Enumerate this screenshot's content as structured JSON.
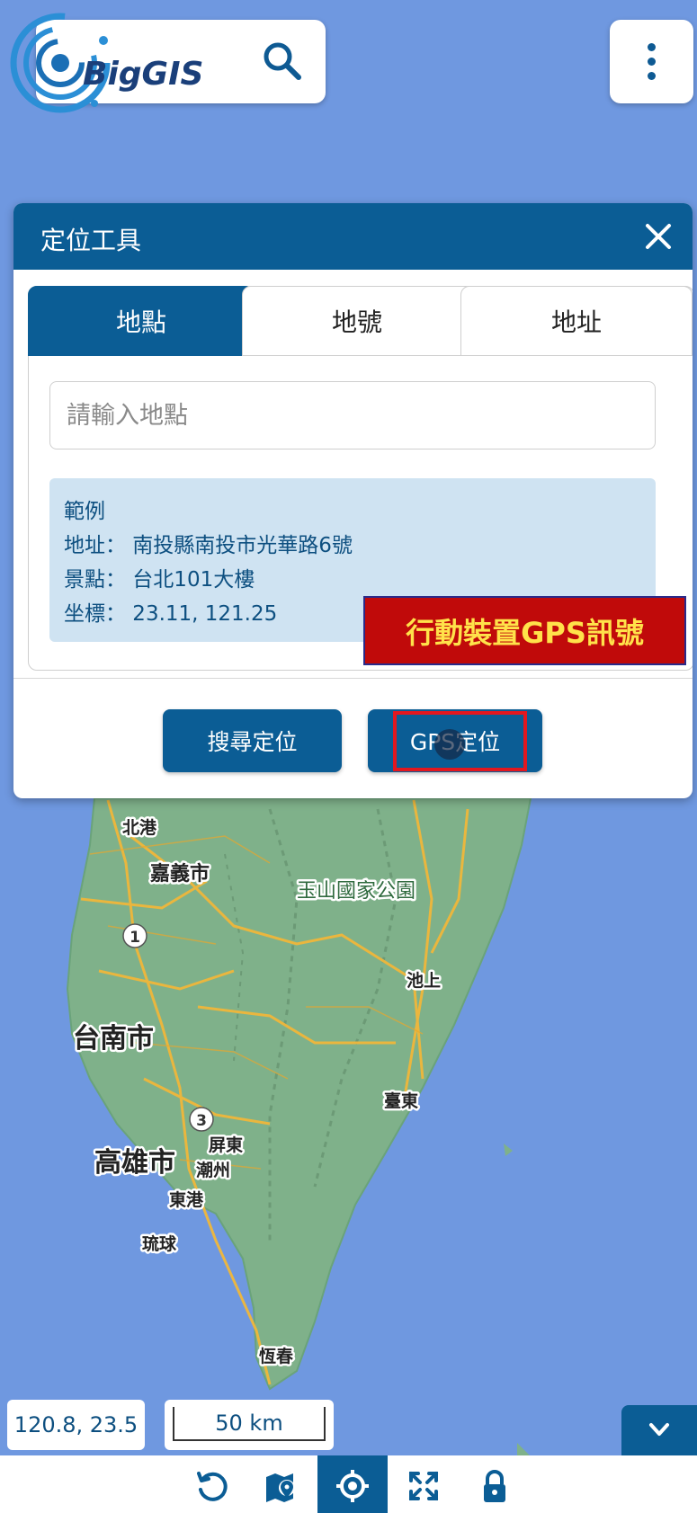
{
  "brand": {
    "name": "BigGIS"
  },
  "header": {
    "search_icon": "search-icon",
    "menu_icon": "more-vertical-icon"
  },
  "panel": {
    "title": "定位工具",
    "tabs": [
      {
        "label": "地點",
        "active": true
      },
      {
        "label": "地號",
        "active": false
      },
      {
        "label": "地址",
        "active": false
      }
    ],
    "input_placeholder": "請輸入地點",
    "input_value": "",
    "example": {
      "heading": "範例",
      "lines": [
        "地址： 南投縣南投市光華路6號",
        "景點： 台北101大樓",
        "坐標： 23.11, 121.25"
      ]
    },
    "buttons": {
      "search": "搜尋定位",
      "gps": "GPS定位"
    }
  },
  "annotation": {
    "callout": "行動裝置GPS訊號",
    "color": "#c00a0a",
    "text_color": "#ffe24a"
  },
  "map": {
    "labels": [
      "北港",
      "嘉義市",
      "玉山國家公園",
      "池上",
      "台南市",
      "臺東",
      "屏東",
      "高雄市",
      "潮州",
      "東港",
      "琉球",
      "恆春"
    ],
    "highway_shields": [
      "1",
      "3"
    ]
  },
  "status": {
    "coordinates": "120.8, 23.5",
    "scale": "50 km"
  },
  "toolbar": {
    "items": [
      {
        "icon": "reset-icon",
        "active": false
      },
      {
        "icon": "map-marker-icon",
        "active": false
      },
      {
        "icon": "locate-crosshair-icon",
        "active": true
      },
      {
        "icon": "fullscreen-icon",
        "active": false
      },
      {
        "icon": "lock-icon",
        "active": false
      }
    ]
  },
  "colors": {
    "primary": "#0b5d95",
    "sea": "#6f98e0",
    "land": "#7fb18a",
    "road": "#f0b73a"
  }
}
